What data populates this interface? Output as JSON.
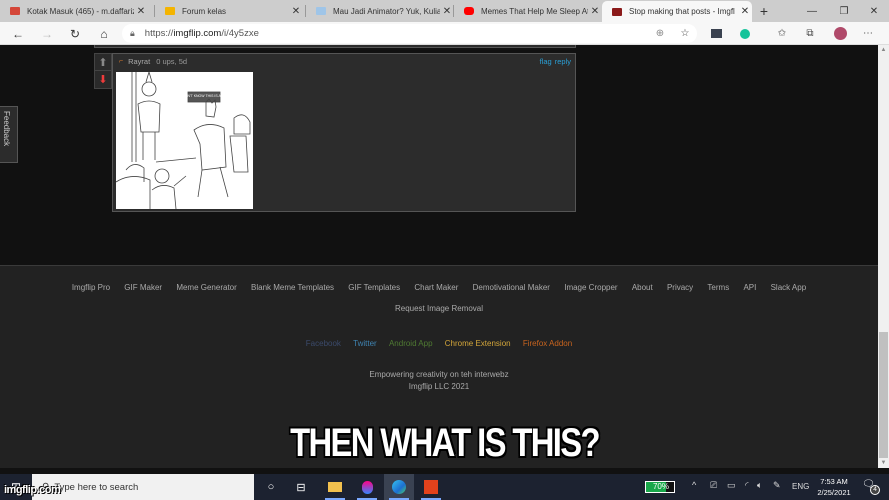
{
  "browser": {
    "tabs": [
      {
        "title": "Kotak Masuk (465) - m.daffariz",
        "icon": "gmail-icon",
        "color": "#d44638",
        "active": false
      },
      {
        "title": "Forum kelas",
        "icon": "classroom-icon",
        "color": "#f4b400",
        "active": false
      },
      {
        "title": "Mau Jadi Animator? Yuk, Kulia",
        "icon": "site-icon",
        "color": "#9fc5e8",
        "active": false
      },
      {
        "title": "Memes That Help Me Sleep At",
        "icon": "youtube-icon",
        "color": "#ff0000",
        "active": false
      },
      {
        "title": "Stop making that posts - Imgfl",
        "icon": "imgflip-icon",
        "color": "#8b1a1a",
        "active": true
      }
    ],
    "new_tab_label": "+",
    "url_prefix": "https://",
    "url_host": "imgflip.com",
    "url_path": "/i/4y5zxe",
    "window_controls": {
      "minimize": "—",
      "restore": "❐",
      "close": "✕"
    }
  },
  "comment": {
    "username": "Rayrat",
    "meta": "0 ups, 5d",
    "actions": [
      "flag",
      "reply"
    ],
    "image_caption": "THEY DON'T KNOW THIS IS A REPOST"
  },
  "feedback_label": "Feedback",
  "footer": {
    "links": [
      "Imgflip Pro",
      "GIF Maker",
      "Meme Generator",
      "Blank Meme Templates",
      "GIF Templates",
      "Chart Maker",
      "Demotivational Maker",
      "Image Cropper",
      "About",
      "Privacy",
      "Terms",
      "API",
      "Slack App"
    ],
    "request_removal": "Request Image Removal",
    "social": [
      {
        "label": "Facebook",
        "color": "#3b4a6b"
      },
      {
        "label": "Twitter",
        "color": "#3f84b3"
      },
      {
        "label": "Android App",
        "color": "#4f7a32"
      },
      {
        "label": "Chrome Extension",
        "color": "#d4a63a"
      },
      {
        "label": "Firefox Addon",
        "color": "#c8641e"
      }
    ],
    "tagline": "Empowering creativity on teh interwebz",
    "copyright": "Imgflip LLC 2021"
  },
  "meme_caption": "THEN WHAT IS THIS?",
  "watermark": "imgflip.com",
  "taskbar": {
    "search_placeholder": "Type here to search",
    "battery_percent": 70,
    "battery_label": "70%",
    "language": "ENG",
    "time": "7:53 AM",
    "date": "2/25/2021",
    "notification_count": "4"
  }
}
